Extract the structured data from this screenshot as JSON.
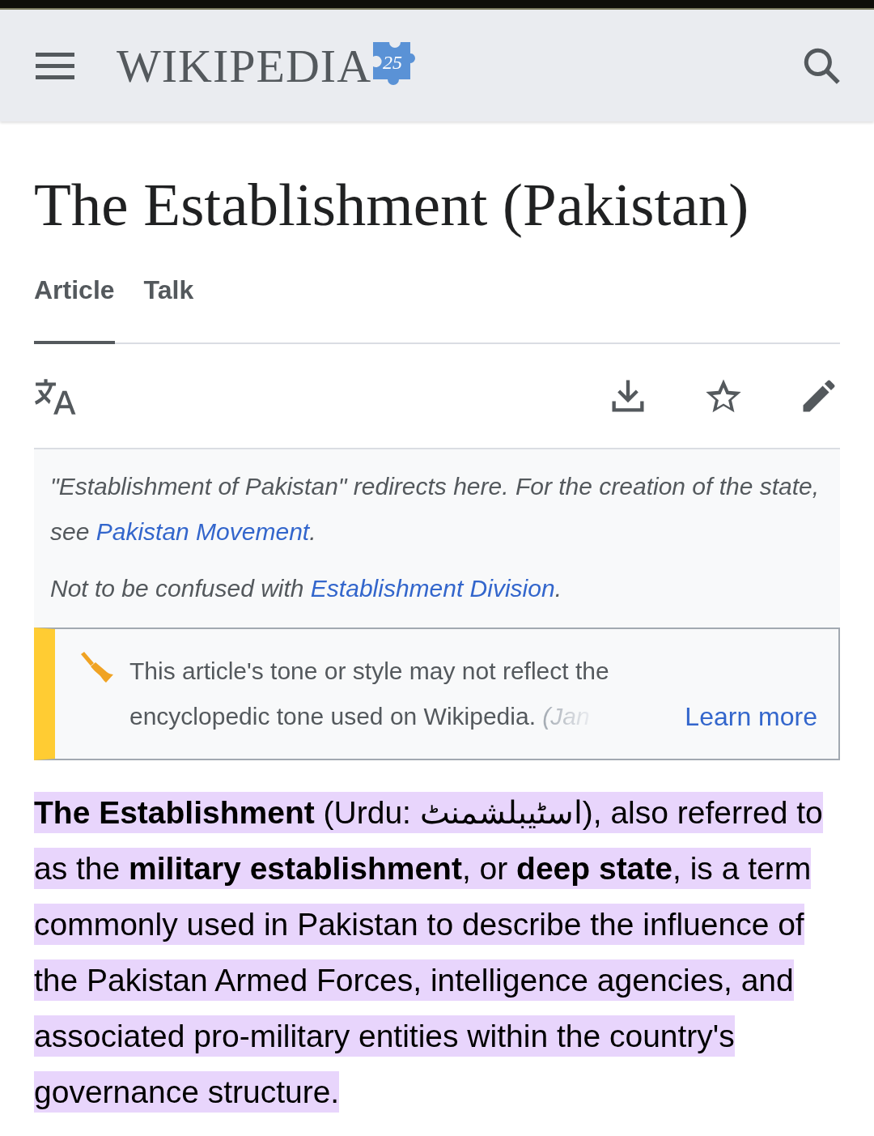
{
  "header": {
    "logo": {
      "wordmark": "WIKIPEDIA",
      "badge": "25"
    }
  },
  "title": "The Establishment (Pakistan)",
  "tabs": [
    {
      "label": "Article",
      "selected": true
    },
    {
      "label": "Talk",
      "selected": false
    }
  ],
  "hatnotes": [
    {
      "before": "\"Establishment of Pakistan\" redirects here. For the creation of the state, see ",
      "link": "Pakistan Movement",
      "after": "."
    },
    {
      "before": "Not to be confused with ",
      "link": "Establishment Division",
      "after": "."
    }
  ],
  "notice": {
    "text": "This article's tone or style may not reflect the encyclopedic tone used on Wikipedia.",
    "faded": "(Jan",
    "link": "Learn more"
  },
  "lead": {
    "text": "**The Establishment** (Urdu: اسٹیبلشمنٹ), also referred to as the **military establishment**, or **deep state**, is a term commonly used in Pakistan to describe the influence of the Pakistan Armed Forces, intelligence agencies, and associated pro-military entities within the country's governance structure.",
    "highlighted": true
  }
}
